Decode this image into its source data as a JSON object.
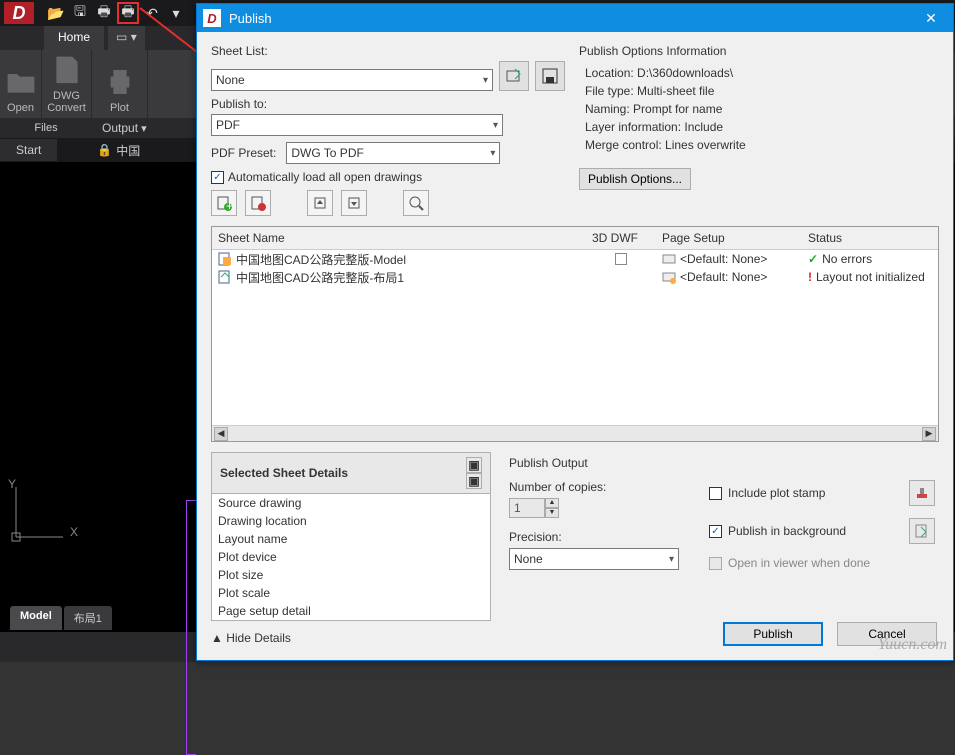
{
  "qat": {
    "logo": "D"
  },
  "ribbon": {
    "home_tab": "Home",
    "open_label": "Open",
    "dwg_convert_label": "DWG\nConvert",
    "plot_label": "Plot",
    "panel_files": "Files",
    "panel_output": "Output",
    "start_tab": "Start",
    "doc_tab": "中国"
  },
  "model_tabs": {
    "model": "Model",
    "layout1": "布局1"
  },
  "dialog": {
    "title": "Publish",
    "sheet_list_label": "Sheet List:",
    "sheet_list_value": "None",
    "publish_to_label": "Publish to:",
    "publish_to_value": "PDF",
    "pdf_preset_label": "PDF Preset:",
    "pdf_preset_value": "DWG To PDF",
    "auto_load_label": "Automatically load all open drawings",
    "info_header": "Publish Options Information",
    "info_location": "Location: D:\\360downloads\\",
    "info_filetype": "File type: Multi-sheet file",
    "info_naming": "Naming: Prompt for name",
    "info_layer": "Layer information: Include",
    "info_merge": "Merge control: Lines overwrite",
    "publish_options_btn": "Publish Options...",
    "col_sheet": "Sheet Name",
    "col_3ddwf": "3D DWF",
    "col_pagesetup": "Page Setup",
    "col_status": "Status",
    "rows": [
      {
        "name": "中国地图CAD公路完整版-Model",
        "pagesetup": "<Default: None>",
        "status": "No errors",
        "status_ok": true
      },
      {
        "name": "中国地图CAD公路完整版-布局1",
        "pagesetup": "<Default: None>",
        "status": "Layout not initialized",
        "status_ok": false
      }
    ],
    "details_title": "Selected Sheet Details",
    "details": {
      "d1": "Source drawing",
      "d2": "Drawing location",
      "d3": "Layout name",
      "d4": "Plot device",
      "d5": "Plot size",
      "d6": "Plot scale",
      "d7": "Page setup detail"
    },
    "output_title": "Publish Output",
    "num_copies_label": "Number of copies:",
    "num_copies_value": "1",
    "precision_label": "Precision:",
    "precision_value": "None",
    "include_stamp": "Include plot stamp",
    "pub_background": "Publish in background",
    "open_viewer": "Open in viewer when done",
    "hide_details": "Hide Details",
    "publish_btn": "Publish",
    "cancel_btn": "Cancel"
  },
  "watermark": "Yuucn.com"
}
